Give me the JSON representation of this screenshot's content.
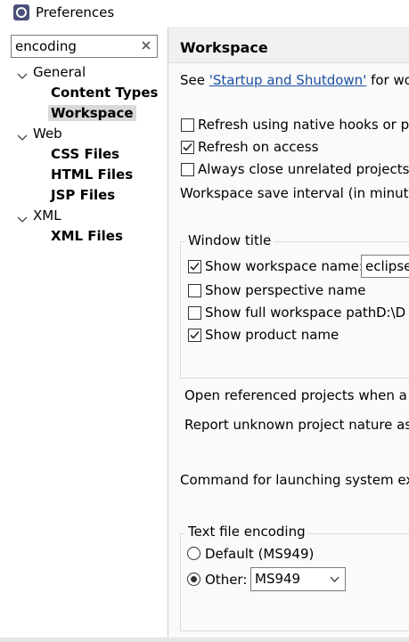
{
  "window": {
    "title": "Preferences"
  },
  "filter": {
    "value": "encoding"
  },
  "tree": {
    "general": "General",
    "content_types": "Content Types",
    "workspace": "Workspace",
    "web": "Web",
    "css_files": "CSS Files",
    "html_files": "HTML Files",
    "jsp_files": "JSP Files",
    "xml": "XML",
    "xml_files": "XML Files"
  },
  "page": {
    "title": "Workspace",
    "see_prefix": "See ",
    "see_link": "'Startup and Shutdown'",
    "see_suffix": " for works",
    "refresh_native": "Refresh using native hooks or polli",
    "refresh_access": "Refresh on access",
    "always_close": "Always close unrelated projects wit",
    "save_interval": "Workspace save interval (in minutes):",
    "window_title_group": "Window title",
    "show_workspace_name": "Show workspace name:",
    "workspace_name_value": "eclipse-",
    "show_perspective_name": "Show perspective name",
    "show_full_path": "Show full workspace path:",
    "full_path_value": "D:\\D",
    "show_product_name": "Show product name",
    "open_referenced": "Open referenced projects when a pro",
    "report_unknown": "Report unknown project nature as:",
    "command_launching": "Command for launching system explo",
    "encoding_group": "Text file encoding",
    "default_option": "Default (MS949)",
    "other_option": "Other:",
    "other_value": "MS949"
  },
  "state": {
    "refresh_native": false,
    "refresh_access": true,
    "always_close": false,
    "show_workspace_name": true,
    "show_perspective_name": false,
    "show_full_path": false,
    "show_product_name": true,
    "encoding_selected": "other"
  },
  "colors": {
    "link": "#1a4fa0",
    "selection": "#d9d9d9",
    "panel": "#f0f0f0"
  }
}
